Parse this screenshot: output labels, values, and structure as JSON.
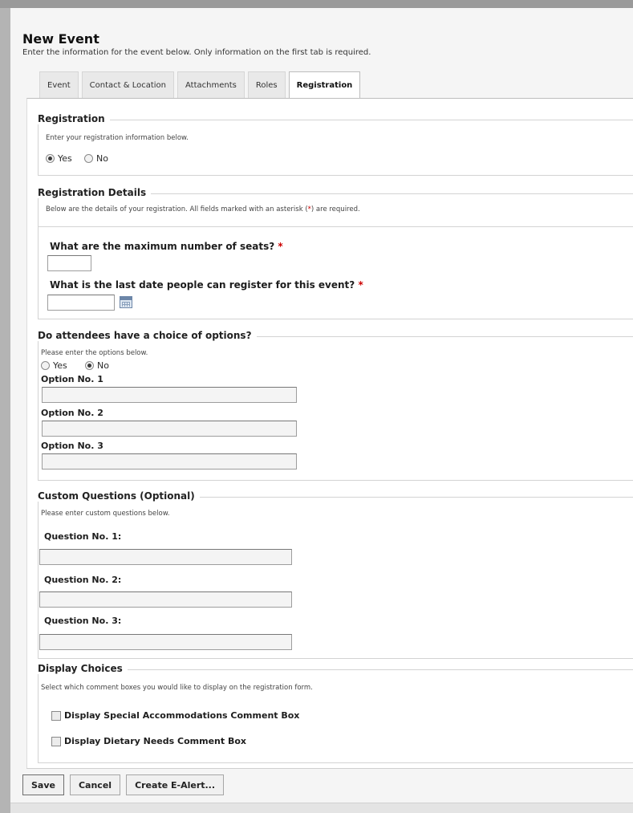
{
  "header": {
    "title": "New Event",
    "subtitle": "Enter the information for the event below. Only information on the first tab is required."
  },
  "tabs": [
    {
      "label": "Event"
    },
    {
      "label": "Contact & Location"
    },
    {
      "label": "Attachments"
    },
    {
      "label": "Roles"
    },
    {
      "label": "Registration",
      "active": true
    }
  ],
  "registration": {
    "legend": "Registration",
    "hint": "Enter your registration information below.",
    "yes_label": "Yes",
    "no_label": "No",
    "selected": "Yes"
  },
  "details": {
    "legend": "Registration Details",
    "hint_before": "Below are the details of your registration. All fields marked with an asterisk (",
    "hint_star": "*",
    "hint_after": ") are required.",
    "seats_question": "What are the maximum number of seats?",
    "seats_value": "",
    "lastdate_question": "What is the last date people can register for this event?",
    "lastdate_value": "",
    "required_mark": "*"
  },
  "options": {
    "legend": "Do attendees have a choice of options?",
    "hint": "Please enter the options below.",
    "yes_label": "Yes",
    "no_label": "No",
    "selected": "No",
    "items": [
      {
        "label": "Option No. 1",
        "value": ""
      },
      {
        "label": "Option No. 2",
        "value": ""
      },
      {
        "label": "Option No. 3",
        "value": ""
      }
    ]
  },
  "custom_questions": {
    "legend": "Custom Questions (Optional)",
    "hint": "Please enter custom questions below.",
    "items": [
      {
        "label": "Question No. 1:",
        "value": ""
      },
      {
        "label": "Question No. 2:",
        "value": ""
      },
      {
        "label": "Question No. 3:",
        "value": ""
      }
    ]
  },
  "display_choices": {
    "legend": "Display Choices",
    "hint": "Select which comment boxes you would like to display on the registration form.",
    "items": [
      {
        "label": "Display Special Accommodations Comment Box",
        "checked": false
      },
      {
        "label": "Display Dietary Needs Comment Box",
        "checked": false
      }
    ]
  },
  "buttons": {
    "save": "Save",
    "cancel": "Cancel",
    "alert": "Create E-Alert..."
  },
  "colors": {
    "required": "#cc0000",
    "border": "#d3d3d3",
    "page_background": "#f5f5f5"
  }
}
